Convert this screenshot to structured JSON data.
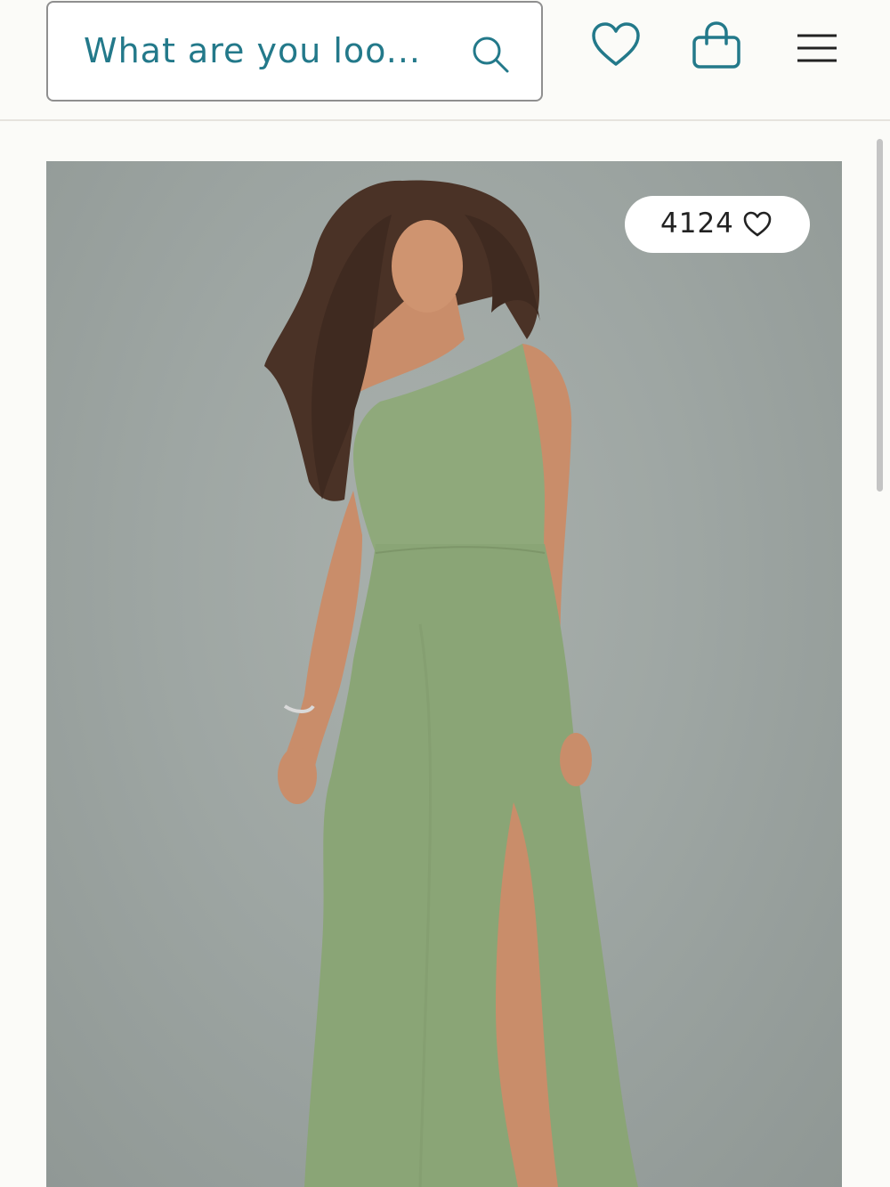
{
  "header": {
    "search": {
      "placeholder": "What are you loo..."
    },
    "icons": [
      "search-icon",
      "heart-icon",
      "shopping-bag-icon",
      "hamburger-menu-icon"
    ]
  },
  "product": {
    "image_alt": "Model wearing a sage green one-shoulder gown with side slit",
    "likes": "4124",
    "likes_icon": "heart-outline-icon"
  },
  "colors": {
    "accent": "#23798a",
    "dress": "#8fa97b",
    "background": "#9ea6a3"
  }
}
